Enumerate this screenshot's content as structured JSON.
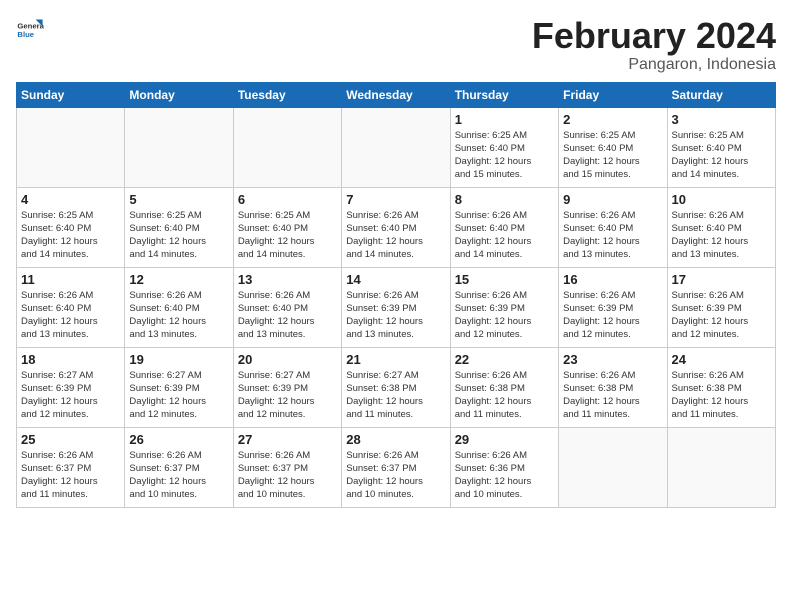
{
  "header": {
    "logo_general": "General",
    "logo_blue": "Blue",
    "month": "February 2024",
    "location": "Pangaron, Indonesia"
  },
  "weekdays": [
    "Sunday",
    "Monday",
    "Tuesday",
    "Wednesday",
    "Thursday",
    "Friday",
    "Saturday"
  ],
  "weeks": [
    [
      {
        "day": "",
        "info": ""
      },
      {
        "day": "",
        "info": ""
      },
      {
        "day": "",
        "info": ""
      },
      {
        "day": "",
        "info": ""
      },
      {
        "day": "1",
        "info": "Sunrise: 6:25 AM\nSunset: 6:40 PM\nDaylight: 12 hours\nand 15 minutes."
      },
      {
        "day": "2",
        "info": "Sunrise: 6:25 AM\nSunset: 6:40 PM\nDaylight: 12 hours\nand 15 minutes."
      },
      {
        "day": "3",
        "info": "Sunrise: 6:25 AM\nSunset: 6:40 PM\nDaylight: 12 hours\nand 14 minutes."
      }
    ],
    [
      {
        "day": "4",
        "info": "Sunrise: 6:25 AM\nSunset: 6:40 PM\nDaylight: 12 hours\nand 14 minutes."
      },
      {
        "day": "5",
        "info": "Sunrise: 6:25 AM\nSunset: 6:40 PM\nDaylight: 12 hours\nand 14 minutes."
      },
      {
        "day": "6",
        "info": "Sunrise: 6:25 AM\nSunset: 6:40 PM\nDaylight: 12 hours\nand 14 minutes."
      },
      {
        "day": "7",
        "info": "Sunrise: 6:26 AM\nSunset: 6:40 PM\nDaylight: 12 hours\nand 14 minutes."
      },
      {
        "day": "8",
        "info": "Sunrise: 6:26 AM\nSunset: 6:40 PM\nDaylight: 12 hours\nand 14 minutes."
      },
      {
        "day": "9",
        "info": "Sunrise: 6:26 AM\nSunset: 6:40 PM\nDaylight: 12 hours\nand 13 minutes."
      },
      {
        "day": "10",
        "info": "Sunrise: 6:26 AM\nSunset: 6:40 PM\nDaylight: 12 hours\nand 13 minutes."
      }
    ],
    [
      {
        "day": "11",
        "info": "Sunrise: 6:26 AM\nSunset: 6:40 PM\nDaylight: 12 hours\nand 13 minutes."
      },
      {
        "day": "12",
        "info": "Sunrise: 6:26 AM\nSunset: 6:40 PM\nDaylight: 12 hours\nand 13 minutes."
      },
      {
        "day": "13",
        "info": "Sunrise: 6:26 AM\nSunset: 6:40 PM\nDaylight: 12 hours\nand 13 minutes."
      },
      {
        "day": "14",
        "info": "Sunrise: 6:26 AM\nSunset: 6:39 PM\nDaylight: 12 hours\nand 13 minutes."
      },
      {
        "day": "15",
        "info": "Sunrise: 6:26 AM\nSunset: 6:39 PM\nDaylight: 12 hours\nand 12 minutes."
      },
      {
        "day": "16",
        "info": "Sunrise: 6:26 AM\nSunset: 6:39 PM\nDaylight: 12 hours\nand 12 minutes."
      },
      {
        "day": "17",
        "info": "Sunrise: 6:26 AM\nSunset: 6:39 PM\nDaylight: 12 hours\nand 12 minutes."
      }
    ],
    [
      {
        "day": "18",
        "info": "Sunrise: 6:27 AM\nSunset: 6:39 PM\nDaylight: 12 hours\nand 12 minutes."
      },
      {
        "day": "19",
        "info": "Sunrise: 6:27 AM\nSunset: 6:39 PM\nDaylight: 12 hours\nand 12 minutes."
      },
      {
        "day": "20",
        "info": "Sunrise: 6:27 AM\nSunset: 6:39 PM\nDaylight: 12 hours\nand 12 minutes."
      },
      {
        "day": "21",
        "info": "Sunrise: 6:27 AM\nSunset: 6:38 PM\nDaylight: 12 hours\nand 11 minutes."
      },
      {
        "day": "22",
        "info": "Sunrise: 6:26 AM\nSunset: 6:38 PM\nDaylight: 12 hours\nand 11 minutes."
      },
      {
        "day": "23",
        "info": "Sunrise: 6:26 AM\nSunset: 6:38 PM\nDaylight: 12 hours\nand 11 minutes."
      },
      {
        "day": "24",
        "info": "Sunrise: 6:26 AM\nSunset: 6:38 PM\nDaylight: 12 hours\nand 11 minutes."
      }
    ],
    [
      {
        "day": "25",
        "info": "Sunrise: 6:26 AM\nSunset: 6:37 PM\nDaylight: 12 hours\nand 11 minutes."
      },
      {
        "day": "26",
        "info": "Sunrise: 6:26 AM\nSunset: 6:37 PM\nDaylight: 12 hours\nand 10 minutes."
      },
      {
        "day": "27",
        "info": "Sunrise: 6:26 AM\nSunset: 6:37 PM\nDaylight: 12 hours\nand 10 minutes."
      },
      {
        "day": "28",
        "info": "Sunrise: 6:26 AM\nSunset: 6:37 PM\nDaylight: 12 hours\nand 10 minutes."
      },
      {
        "day": "29",
        "info": "Sunrise: 6:26 AM\nSunset: 6:36 PM\nDaylight: 12 hours\nand 10 minutes."
      },
      {
        "day": "",
        "info": ""
      },
      {
        "day": "",
        "info": ""
      }
    ]
  ]
}
